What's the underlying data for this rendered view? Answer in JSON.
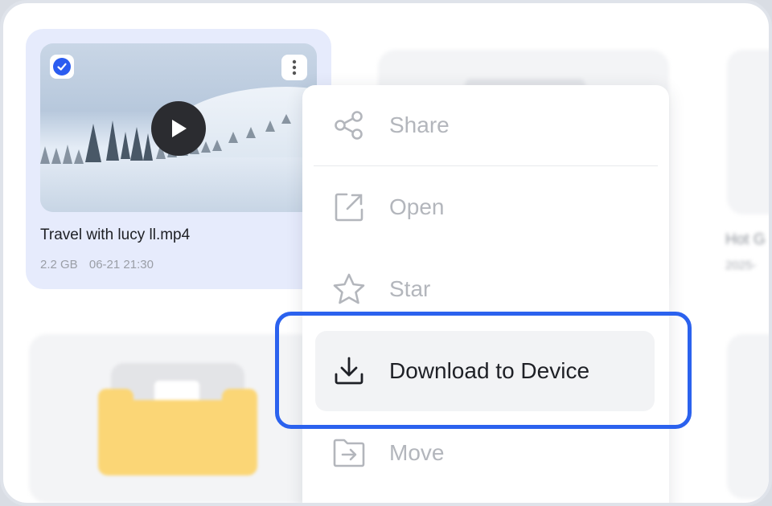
{
  "video_card": {
    "file_name": "Travel with lucy ll.mp4",
    "size": "2.2 GB",
    "date": "06-21 21:30",
    "selected": true
  },
  "context_menu": {
    "items": [
      {
        "label": "Share",
        "icon": "share-icon"
      },
      {
        "label": "Open",
        "icon": "open-external-icon"
      },
      {
        "label": "Star",
        "icon": "star-icon"
      },
      {
        "label": "Download to Device",
        "icon": "download-icon",
        "highlighted": true
      },
      {
        "label": "Move",
        "icon": "move-folder-icon"
      }
    ]
  },
  "background_card": {
    "title_fragment": "Hot G",
    "meta_fragment": "2025-"
  },
  "colors": {
    "accent": "#2b62ee",
    "selected_card": "#e6ebfc",
    "folder": "#fbd676",
    "muted_text": "#b3b6bc"
  }
}
